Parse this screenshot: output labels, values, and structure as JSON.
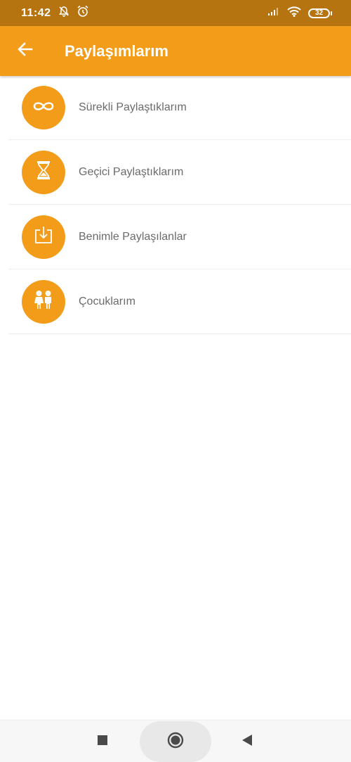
{
  "status_bar": {
    "time": "11:42",
    "battery": "32",
    "icons": [
      "notifications-off-icon",
      "alarm-icon",
      "signal-icon",
      "wifi-icon",
      "battery-icon"
    ]
  },
  "header": {
    "title": "Paylaşımlarım",
    "back_icon": "arrow-left-icon"
  },
  "menu": {
    "items": [
      {
        "label": "Sürekli Paylaştıklarım",
        "icon": "infinity-icon"
      },
      {
        "label": "Geçici Paylaştıklarım",
        "icon": "hourglass-icon"
      },
      {
        "label": "Benimle Paylaşılanlar",
        "icon": "download-icon"
      },
      {
        "label": "Çocuklarım",
        "icon": "children-icon"
      }
    ]
  },
  "nav_bar": {
    "icons": [
      "recents-square-icon",
      "home-circle-icon",
      "back-triangle-icon"
    ]
  },
  "colors": {
    "accent": "#f29c19",
    "status_bar": "#b5740f",
    "label_text": "#6b6b6b"
  }
}
